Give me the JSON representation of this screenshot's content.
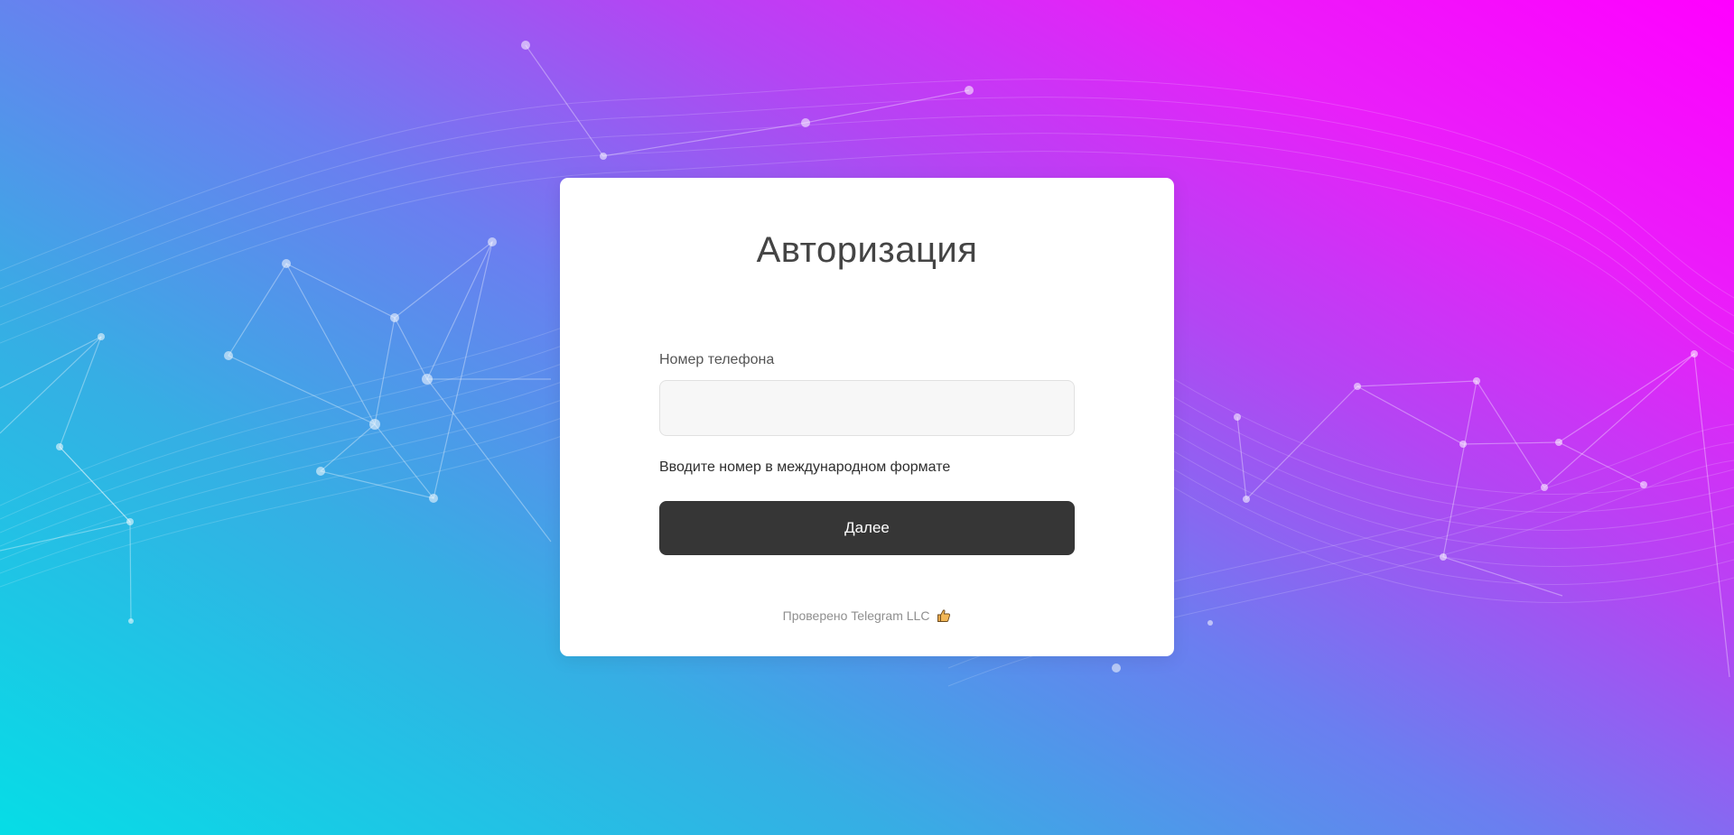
{
  "page": {
    "background_colors": [
      "#06dde6",
      "#36aee4",
      "#6b7ef0",
      "#b445f3",
      "#e91ff9",
      "#ff00ff"
    ]
  },
  "auth": {
    "title": "Авторизация",
    "phone_label": "Номер телефона",
    "phone_value": "",
    "phone_placeholder": "",
    "hint": "Вводите номер в международном формате",
    "next_button": "Далее",
    "verified_text": "Проверено Telegram LLC",
    "verified_icon": "thumbs-up-icon"
  },
  "colors": {
    "button_bg": "#363636",
    "input_bg": "#f7f7f7",
    "title_text": "#444444"
  }
}
